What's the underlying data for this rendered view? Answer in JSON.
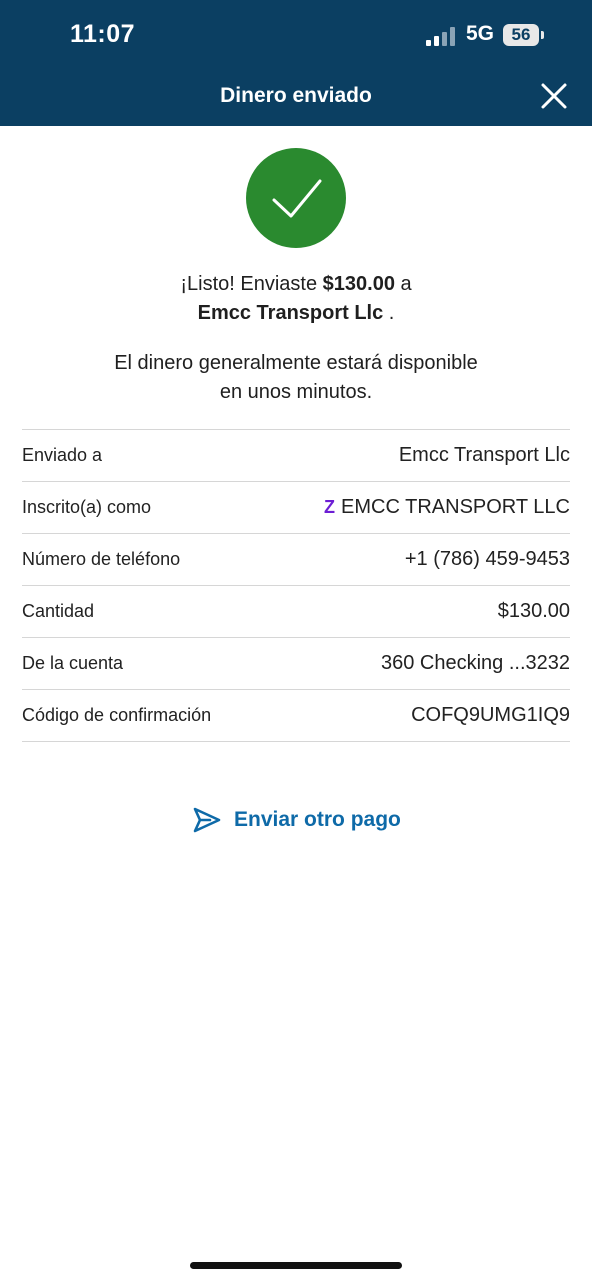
{
  "status_bar": {
    "time": "11:07",
    "network": "5G",
    "battery": "56"
  },
  "header": {
    "title": "Dinero enviado",
    "background": "#0b3f62"
  },
  "confirmation": {
    "prefix": "¡Listo! Enviaste ",
    "amount": "$130.00",
    "connector": " a",
    "recipient": "Emcc Transport Llc",
    "suffix": " .",
    "availability_line1": "El dinero generalmente estará disponible",
    "availability_line2": "en unos minutos.",
    "icon_color": "#2a8a2f"
  },
  "details": [
    {
      "label": "Enviado a",
      "value": "Emcc Transport Llc"
    },
    {
      "label": "Inscrito(a) como",
      "value": "EMCC TRANSPORT LLC",
      "icon": "zelle-icon"
    },
    {
      "label": "Número de teléfono",
      "value": "+1 (786) 459-9453"
    },
    {
      "label": "Cantidad",
      "value": "$130.00"
    },
    {
      "label": "De la cuenta",
      "value": "360 Checking ...3232"
    },
    {
      "label": "Código de confirmación",
      "value": "COFQ9UMG1IQ9"
    }
  ],
  "zelle_symbol": "Z",
  "actions": {
    "send_another": "Enviar otro pago",
    "accent": "#0e6aa8"
  }
}
